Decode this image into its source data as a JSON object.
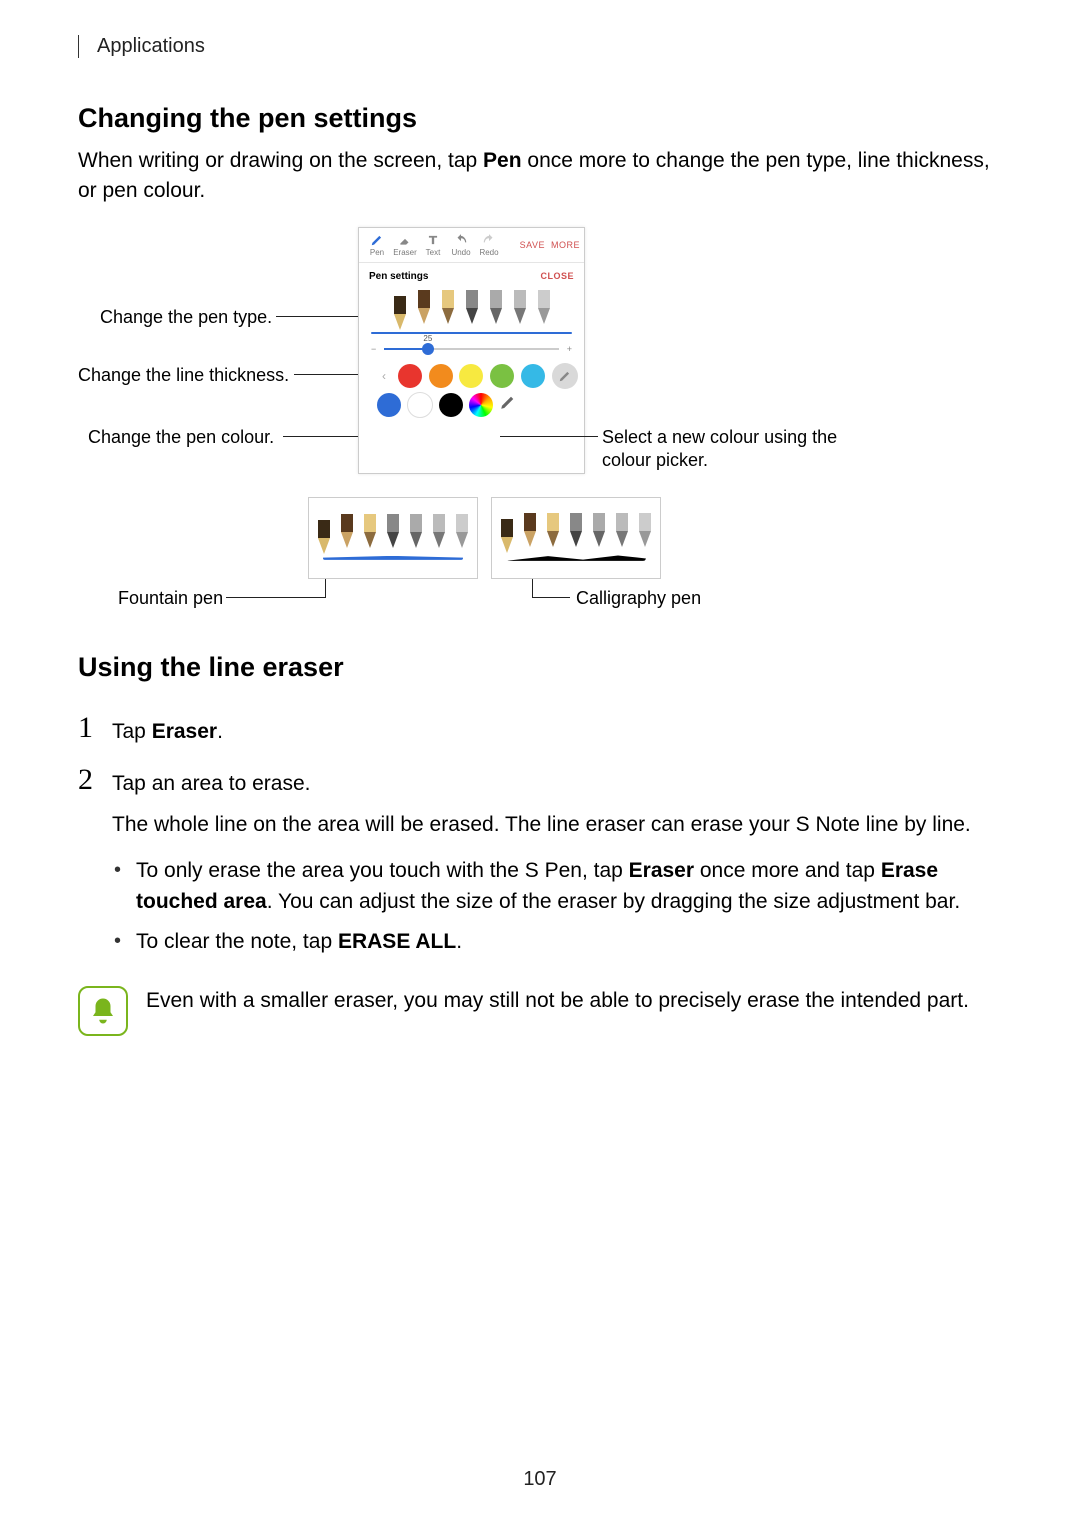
{
  "header": {
    "section": "Applications"
  },
  "section1": {
    "title": "Changing the pen settings",
    "intro_pre": "When writing or drawing on the screen, tap ",
    "intro_bold": "Pen",
    "intro_post": " once more to change the pen type, line thickness, or pen colour."
  },
  "figure": {
    "callout_pen_type": "Change the pen type.",
    "callout_thickness": "Change the line thickness.",
    "callout_colour": "Change the pen colour.",
    "callout_picker": "Select a new colour using the colour picker.",
    "callout_fountain": "Fountain pen",
    "callout_calligraphy": "Calligraphy pen",
    "panel": {
      "toolbar": {
        "pen": "Pen",
        "eraser": "Eraser",
        "text": "Text",
        "undo": "Undo",
        "redo": "Redo",
        "save": "SAVE",
        "more": "MORE"
      },
      "title": "Pen settings",
      "close": "CLOSE",
      "slider_value": "25",
      "slider_minus": "−",
      "slider_plus": "+",
      "color_row1": [
        "#e8352e",
        "#f28b1d",
        "#f7e940",
        "#7ac142",
        "#35b9e6"
      ],
      "color_row2_left_nav": "‹",
      "color_row2_right_nav": "›",
      "color_row2_prefix": [
        "#2e6cd6",
        "#ffffff",
        "#000000"
      ]
    }
  },
  "section2": {
    "title": "Using the line eraser",
    "step1_pre": "Tap ",
    "step1_bold": "Eraser",
    "step1_post": ".",
    "step2_line1": "Tap an area to erase.",
    "step2_line2": "The whole line on the area will be erased. The line eraser can erase your S Note line by line.",
    "bullets": {
      "b1_pre": "To only erase the area you touch with the S Pen, tap ",
      "b1_bold1": "Eraser",
      "b1_mid": " once more and tap ",
      "b1_bold2": "Erase touched area",
      "b1_post": ". You can adjust the size of the eraser by dragging the size adjustment bar.",
      "b2_pre": "To clear the note, tap ",
      "b2_bold": "ERASE ALL",
      "b2_post": "."
    },
    "note": "Even with a smaller eraser, you may still not be able to precisely erase the intended part."
  },
  "page_number": "107"
}
